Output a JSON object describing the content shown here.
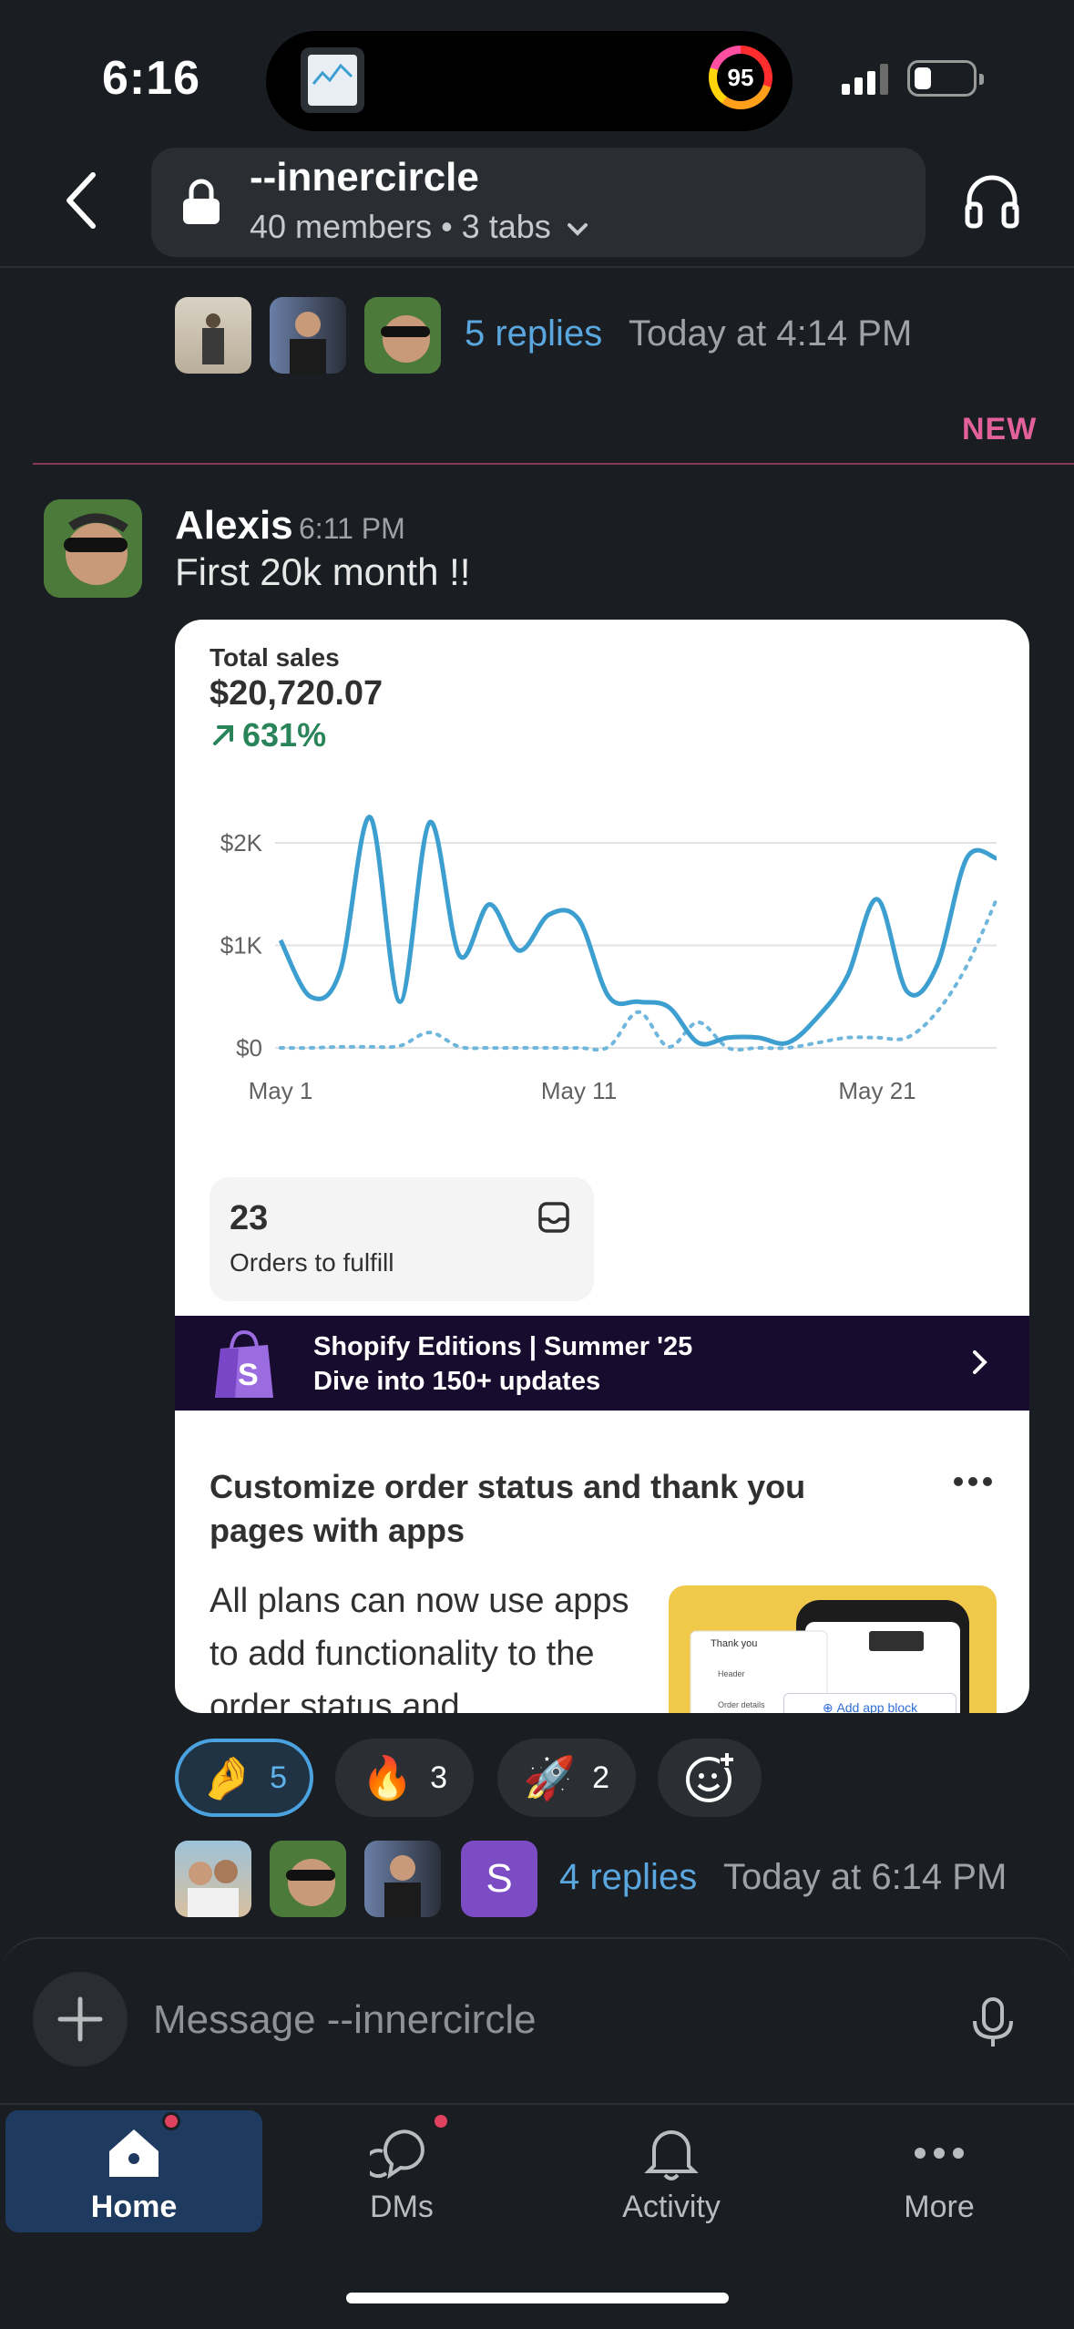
{
  "status": {
    "time": "6:16",
    "activity_ring": "95"
  },
  "header": {
    "channel": "--innercircle",
    "subtitle": "40 members • 3 tabs"
  },
  "prev_thread": {
    "replies": "5 replies",
    "time": "Today at 4:14 PM"
  },
  "new_divider": "NEW",
  "message": {
    "author": "Alexis",
    "time": "6:11 PM",
    "text": "First 20k month !!",
    "card": {
      "total_label": "Total sales",
      "total_value": "$20,720.07",
      "change": "631%",
      "orders_count": "23",
      "orders_label": "Orders to fulfill",
      "banner_title": "Shopify Editions | Summer '25",
      "banner_sub": "Dive into 150+ updates",
      "custom_title": "Customize order status and thank you pages with apps",
      "custom_body": "All plans can now use apps to add functionality to the order status and",
      "promo_tab": "Thank you",
      "promo_header": "Header",
      "promo_order": "Order details",
      "promo_button": "Add app block"
    },
    "reactions": [
      {
        "emoji": "🤌",
        "count": "5"
      },
      {
        "emoji": "🔥",
        "count": "3"
      },
      {
        "emoji": "🚀",
        "count": "2"
      }
    ],
    "thread": {
      "avatar_letter": "S",
      "replies": "4 replies",
      "time": "Today at 6:14 PM"
    }
  },
  "chart_data": {
    "type": "line",
    "ylim": [
      0,
      2200
    ],
    "yticks": [
      "$0",
      "$1K",
      "$2K"
    ],
    "xticks": [
      "May 1",
      "May 11",
      "May 21"
    ],
    "x": [
      1,
      2,
      3,
      4,
      5,
      6,
      7,
      8,
      9,
      10,
      11,
      12,
      13,
      14,
      15,
      16,
      17,
      18,
      19,
      20,
      21,
      22,
      23,
      24,
      25
    ],
    "series": [
      {
        "values": [
          1050,
          500,
          750,
          2250,
          450,
          2200,
          900,
          1400,
          950,
          1300,
          1250,
          500,
          450,
          400,
          50,
          100,
          100,
          50,
          300,
          700,
          1450,
          550,
          800,
          1850,
          1850
        ]
      },
      {
        "values": [
          0,
          0,
          10,
          10,
          20,
          150,
          10,
          0,
          0,
          0,
          0,
          10,
          350,
          10,
          250,
          0,
          0,
          0,
          50,
          100,
          100,
          100,
          350,
          800,
          1450
        ]
      }
    ]
  },
  "composer": {
    "placeholder": "Message --innercircle"
  },
  "tabs": [
    {
      "label": "Home"
    },
    {
      "label": "DMs"
    },
    {
      "label": "Activity"
    },
    {
      "label": "More"
    }
  ],
  "colors": {
    "accent": "#5aa7e0",
    "chart_line": "#3d9fd0",
    "growth": "#29845a",
    "unread": "#e0415f"
  }
}
